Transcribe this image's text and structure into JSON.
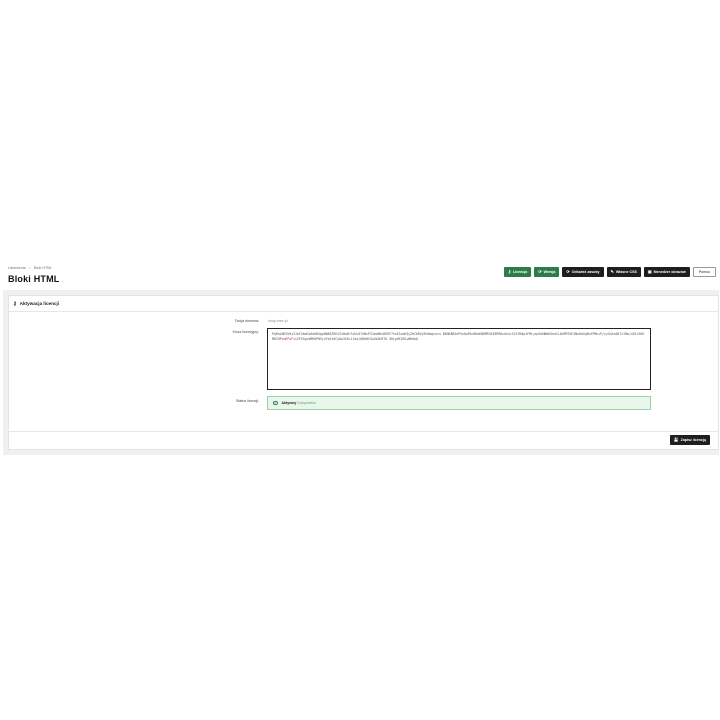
{
  "breadcrumb": {
    "items": [
      "Ustawienia",
      "Bloki HTML"
    ],
    "separator": ">"
  },
  "page": {
    "title": "Bloki HTML"
  },
  "toolbar": {
    "buttons": [
      {
        "label": "Licencja",
        "icon": "key-icon",
        "style": "green"
      },
      {
        "label": "Wersja",
        "icon": "refresh-icon",
        "style": "green"
      },
      {
        "label": "Odśwież zasoby",
        "icon": "refresh-icon",
        "style": "dark"
      },
      {
        "label": "Własne CSS",
        "icon": "edit-icon",
        "style": "dark"
      },
      {
        "label": "Menedżer obrazów",
        "icon": "image-icon",
        "style": "dark"
      },
      {
        "label": "Pomoc",
        "icon": "",
        "style": "outline"
      }
    ]
  },
  "card": {
    "title": "Aktywacja licencji",
    "domain_label": "Twoja domena:",
    "domain_value": "shop.mee.pl",
    "key_label": "Klucz licencyjny:",
    "key_part1": "PqRhxNE2b9y3JwF4kmGs6aKN4gpDW8ATRH1ZsHa8r3vUL07eNcP3JmvNKz6K9F7hsE3uuK5yZbCbRVyBrDmqsnzs B0OK8B4ePXnQwPbn5HaEWDMR3kE8PR6cbXurS2IYN4ptFMLyqu5dHNmUSeaIL8dPRTbF4Nu6bVgBufPMn+P/cyGuXs087cIBm/xD1iSKUM81RPv",
    "key_highlight": "uRFuFi",
    "key_part2": "v2FSSgvdBH6PN5jxFqYi0CyOw3X0+11ko/QHbHt5wUsAHSTA 3HLgVK2EO+WHdaQ",
    "status_label": "Status licencji:",
    "status_value": "Aktywny",
    "status_note": "Dożywotnio",
    "save_label": "Zapisz licencję"
  },
  "colors": {
    "green_button": "#2e7d48",
    "dark_button": "#1e1e1e",
    "status_bg": "#e8f6ec",
    "status_border": "#9bd2a9"
  }
}
